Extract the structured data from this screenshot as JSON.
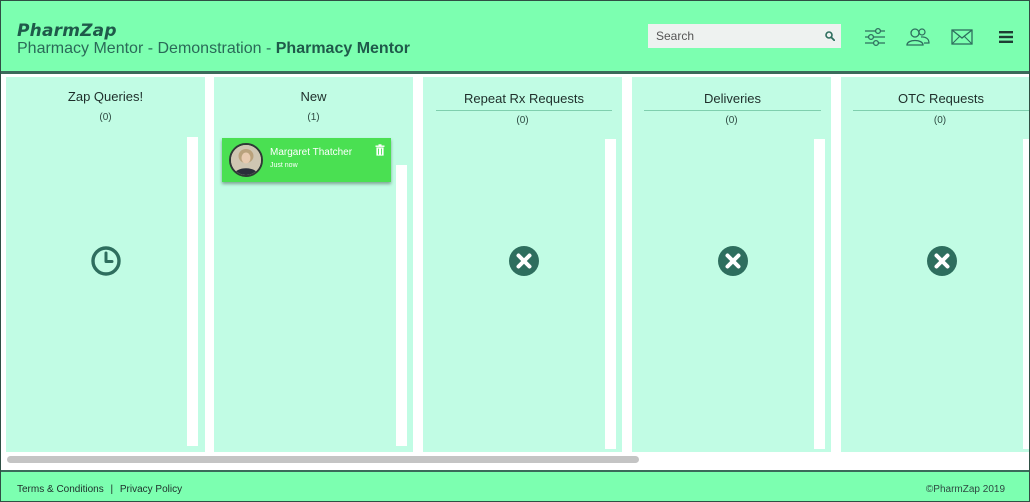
{
  "header": {
    "logo": "PharmZap",
    "subtitle_prefix": "Pharmacy Mentor - Demonstration - ",
    "subtitle_bold": "Pharmacy Mentor",
    "search_placeholder": "Search",
    "icons": [
      "search-icon",
      "sliders-icon",
      "users-icon",
      "mail-icon",
      "hamburger-menu-icon"
    ]
  },
  "columns": [
    {
      "title": "Zap Queries!",
      "count": "(0)",
      "icon": "clock-icon"
    },
    {
      "title": "New",
      "count": "(1)",
      "icon": ""
    },
    {
      "title": "Repeat Rx Requests",
      "count": "(0)",
      "icon": "close-circle-icon"
    },
    {
      "title": "Deliveries",
      "count": "(0)",
      "icon": "close-circle-icon"
    },
    {
      "title": "OTC Requests",
      "count": "(0)",
      "icon": "close-circle-icon"
    }
  ],
  "card": {
    "name": "Margaret Thatcher",
    "time": "Just now",
    "icon": "trash-icon"
  },
  "footer": {
    "terms": "Terms & Conditions",
    "separator": "|",
    "privacy": "Privacy Policy",
    "copyright": "©PharmZap 2019"
  },
  "colors": {
    "header_bg": "#7cffb0",
    "column_bg": "#c1fce4",
    "card_bg": "#4ae052",
    "accent_dark": "#2e6e5e"
  }
}
